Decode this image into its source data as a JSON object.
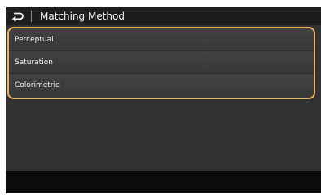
{
  "header": {
    "back_icon": "back-arrow-icon",
    "title": "Matching Method"
  },
  "options": [
    {
      "label": "Perceptual"
    },
    {
      "label": "Saturation"
    },
    {
      "label": "Colorimetric"
    }
  ],
  "colors": {
    "selection_border": "#e8b35a",
    "background": "#313131",
    "title_bar": "#1e1e1e",
    "text": "#f0f0f0"
  }
}
